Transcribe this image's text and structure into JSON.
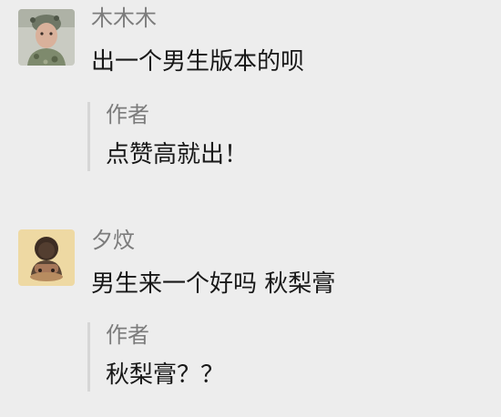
{
  "comments": [
    {
      "username": "木木木",
      "text": "出一个男生版本的呗",
      "reply": {
        "author": "作者",
        "text": "点赞高就出！"
      }
    },
    {
      "username": "夕炆",
      "text": "男生来一个好吗 秋梨膏",
      "reply": {
        "author": "作者",
        "text": "秋梨膏？？"
      }
    }
  ],
  "colors": {
    "background": "#ededed",
    "username": "#7c7c7c",
    "text": "#181818",
    "reply_bar": "#d6d6d6"
  }
}
